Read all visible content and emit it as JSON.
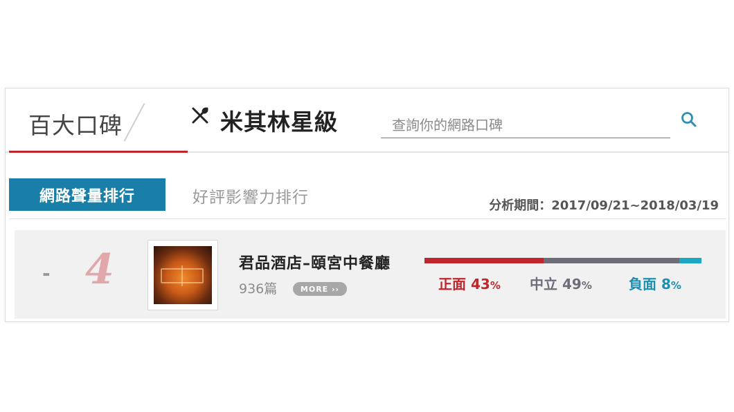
{
  "top_tabs": {
    "tab1_label": "百大口碑",
    "tab2_label": "米其林星級"
  },
  "search": {
    "placeholder": "查詢你的網路口碑"
  },
  "sub_tabs": {
    "active_label": "網路聲量排行",
    "inactive_label": "好評影響力排行"
  },
  "period": {
    "text": "分析期間：2017/09/21~2018/03/19"
  },
  "ranking": {
    "items": [
      {
        "trend": "-",
        "rank": "4",
        "name": "君品酒店–頤宮中餐廳",
        "count": "936篇",
        "more_label": "MORE ››",
        "sentiment": {
          "positive_label": "正面",
          "positive_value": 43,
          "positive_text": "43",
          "neutral_label": "中立",
          "neutral_value": 49,
          "neutral_text": "49",
          "negative_label": "負面",
          "negative_value": 8,
          "negative_text": "8",
          "unit": "%"
        }
      }
    ]
  },
  "colors": {
    "accent_red": "#c0252b",
    "neutral_gray": "#6d6d7a",
    "negative_teal": "#1ba6c2",
    "active_tab_blue": "#1a7fa8"
  }
}
